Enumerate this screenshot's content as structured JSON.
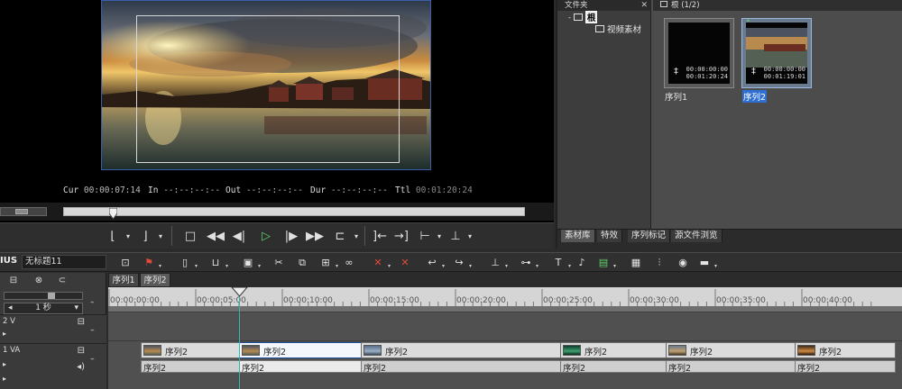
{
  "preview": {
    "cur_label": "Cur",
    "cur_value": "00:00:07:14",
    "in_label": "In",
    "in_value": "--:--:--:--",
    "out_label": "Out",
    "out_value": "--:--:--:--",
    "dur_label": "Dur",
    "dur_value": "--:--:--:--",
    "ttl_label": "Ttl",
    "ttl_value": "00:01:20:24",
    "scrub_position": 0.1
  },
  "bin": {
    "folder_title": "文件夹",
    "close_glyph": "✕",
    "root_label": "根",
    "subfolder_label": "视频素材",
    "content_title": "根 (1/2)",
    "clips": [
      {
        "name": "序列1",
        "tc_in": "00:00:00:00",
        "tc_dur": "00:01:20:24",
        "selected": false
      },
      {
        "name": "序列2",
        "tc_in": "00:00:00:00",
        "tc_dur": "00:01:19:01",
        "selected": true
      }
    ],
    "tabs": [
      "素材库",
      "特效",
      "序列标记",
      "源文件浏览"
    ]
  },
  "timeline_bar": {
    "brand": "IUS",
    "project_name": "无标题11"
  },
  "sequence_tabs": [
    "序列1",
    "序列2"
  ],
  "track_header": {
    "zoom_value": "1 秒",
    "tracks": [
      {
        "name": "2 V"
      },
      {
        "name": "1 VA"
      }
    ]
  },
  "ruler": {
    "labels": [
      "00:00:00:00",
      "00:00:05:00",
      "00:00:10:00",
      "00:00:15:00",
      "00:00:20:00",
      "00:00:25:00",
      "00:00:30:00",
      "00:00:35:00",
      "00:00:40:00"
    ]
  },
  "timeline_clips": {
    "video": [
      "序列2",
      "序列2",
      "序列2",
      "序列2",
      "序列2",
      "序列2"
    ],
    "audio": [
      "序列2",
      "序列2",
      "序列2",
      "序列2",
      "序列2",
      "序列2"
    ]
  },
  "colors": {
    "accent_blue": "#2f6fd1",
    "playhead": "#2fb7b7",
    "play_green": "#5fcf6a"
  }
}
